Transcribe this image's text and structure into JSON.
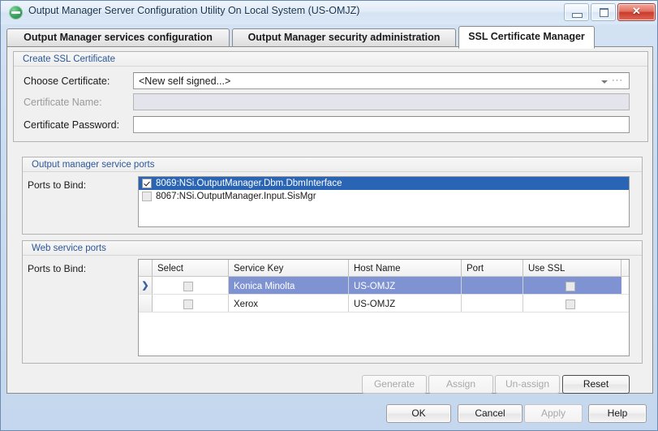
{
  "window": {
    "title": "Output Manager Server Configuration Utility On Local System (US-OMJZ)",
    "minimize_label": "Minimize",
    "maximize_label": "Maximize",
    "close_label": "✕"
  },
  "tabs": [
    {
      "label": "Output Manager services configuration",
      "active": false
    },
    {
      "label": "Output Manager security administration",
      "active": false
    },
    {
      "label": "SSL Certificate Manager",
      "active": true
    }
  ],
  "create_ssl_group": {
    "title": "Create SSL Certificate",
    "choose_certificate": {
      "label": "Choose Certificate:",
      "value": "<New self signed...>",
      "dots": "···"
    },
    "certificate_name": {
      "label": "Certificate Name:",
      "value": "",
      "disabled": true
    },
    "certificate_password": {
      "label": "Certificate Password:",
      "value": ""
    }
  },
  "service_ports_group": {
    "title": "Output manager service ports",
    "ports_to_bind_label": "Ports to Bind:",
    "items": [
      {
        "label": "8069:NSi.OutputManager.Dbm.DbmInterface",
        "checked": true,
        "selected": true
      },
      {
        "label": "8067:NSi.OutputManager.Input.SisMgr",
        "checked": false,
        "selected": false
      }
    ]
  },
  "web_service_ports_group": {
    "title": "Web service ports",
    "ports_to_bind_label": "Ports to Bind:",
    "columns": [
      "Select",
      "Service Key",
      "Host Name",
      "Port",
      "Use SSL"
    ],
    "rows": [
      {
        "indicator": "❯",
        "select": false,
        "service_key": "Konica Minolta",
        "host_name": "US-OMJZ",
        "port": "",
        "use_ssl": false,
        "selected": true
      },
      {
        "indicator": "",
        "select": false,
        "service_key": "Xerox",
        "host_name": "US-OMJZ",
        "port": "",
        "use_ssl": false,
        "selected": false
      }
    ]
  },
  "action_buttons": [
    {
      "label": "Generate",
      "disabled": true,
      "default": false
    },
    {
      "label": "Assign",
      "disabled": true,
      "default": false
    },
    {
      "label": "Un-assign",
      "disabled": true,
      "default": false
    },
    {
      "label": "Reset",
      "disabled": false,
      "default": true
    }
  ],
  "dialog_buttons": [
    {
      "label": "OK",
      "disabled": false
    },
    {
      "label": "Cancel",
      "disabled": false
    },
    {
      "label": "Apply",
      "disabled": true
    },
    {
      "label": "Help",
      "disabled": false
    }
  ],
  "colors": {
    "selection_blue": "#2a64b4",
    "grid_selection": "#7f93d3",
    "group_title": "#2b5797",
    "window_chrome": "#cbdcf0"
  }
}
